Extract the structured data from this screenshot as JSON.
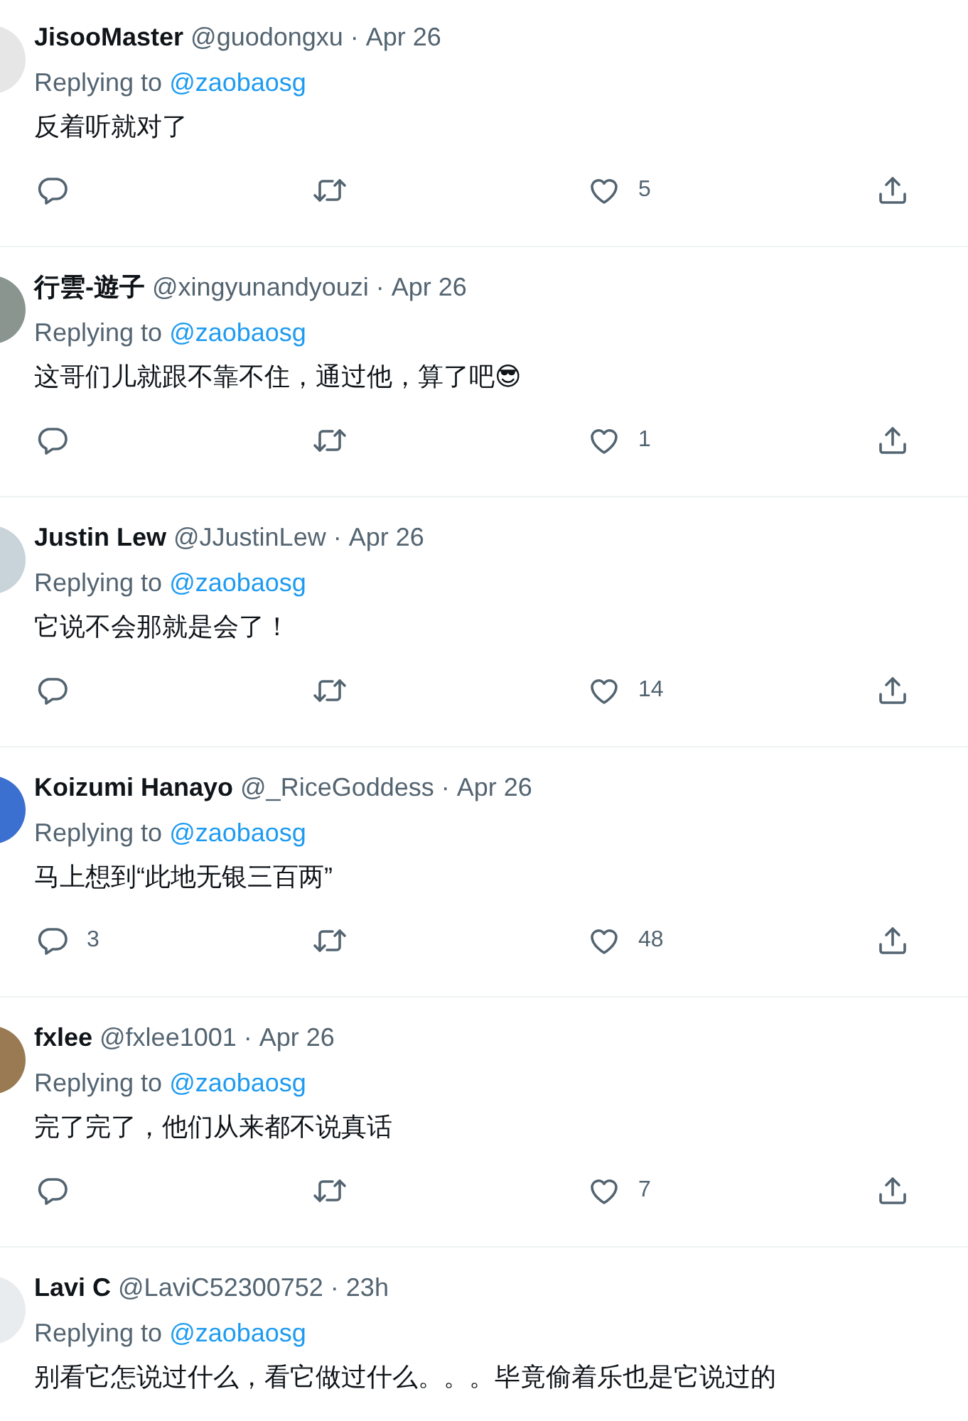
{
  "tweets": [
    {
      "name": "JisooMaster",
      "handle": "@guodongxu",
      "separator": "·",
      "time": "Apr 26",
      "reply_prefix": "Replying to",
      "reply_to": "@zaobaosg",
      "text": "反着听就对了",
      "avatar": {
        "color": "#e6e6e6"
      },
      "like_count": "5",
      "show_actions": true
    },
    {
      "name": "行雲-遊子",
      "handle": "@xingyunandyouzi",
      "separator": "·",
      "time": "Apr 26",
      "reply_prefix": "Replying to",
      "reply_to": "@zaobaosg",
      "text": "这哥们儿就跟不靠不住，通过他，算了吧😎",
      "avatar": {
        "color": "#8a9590"
      },
      "like_count": "1",
      "show_actions": true
    },
    {
      "name": "Justin Lew",
      "handle": "@JJustinLew",
      "separator": "·",
      "time": "Apr 26",
      "reply_prefix": "Replying to",
      "reply_to": "@zaobaosg",
      "text": "它说不会那就是会了！",
      "avatar": {
        "color": "#c9d3da"
      },
      "like_count": "14",
      "show_actions": true
    },
    {
      "name": "Koizumi Hanayo",
      "handle": "@_RiceGoddess",
      "separator": "·",
      "time": "Apr 26",
      "reply_prefix": "Replying to",
      "reply_to": "@zaobaosg",
      "text": "马上想到“此地无银三百两”",
      "avatar": {
        "color": "#3b6fd0"
      },
      "reply_count": "3",
      "like_count": "48",
      "show_actions": true
    },
    {
      "name": "fxlee",
      "handle": "@fxlee1001",
      "separator": "·",
      "time": "Apr 26",
      "reply_prefix": "Replying to",
      "reply_to": "@zaobaosg",
      "text": "完了完了，他们从来都不说真话",
      "avatar": {
        "color": "#9a7a52"
      },
      "like_count": "7",
      "show_actions": true
    },
    {
      "name": "Lavi C",
      "handle": "@LaviC52300752",
      "separator": "·",
      "time": "23h",
      "reply_prefix": "Replying to",
      "reply_to": "@zaobaosg",
      "text": "别看它怎说过什么，看它做过什么。。。毕竟偷着乐也是它说过的",
      "avatar": {
        "color": "#e8ecee"
      },
      "show_actions": false
    }
  ]
}
